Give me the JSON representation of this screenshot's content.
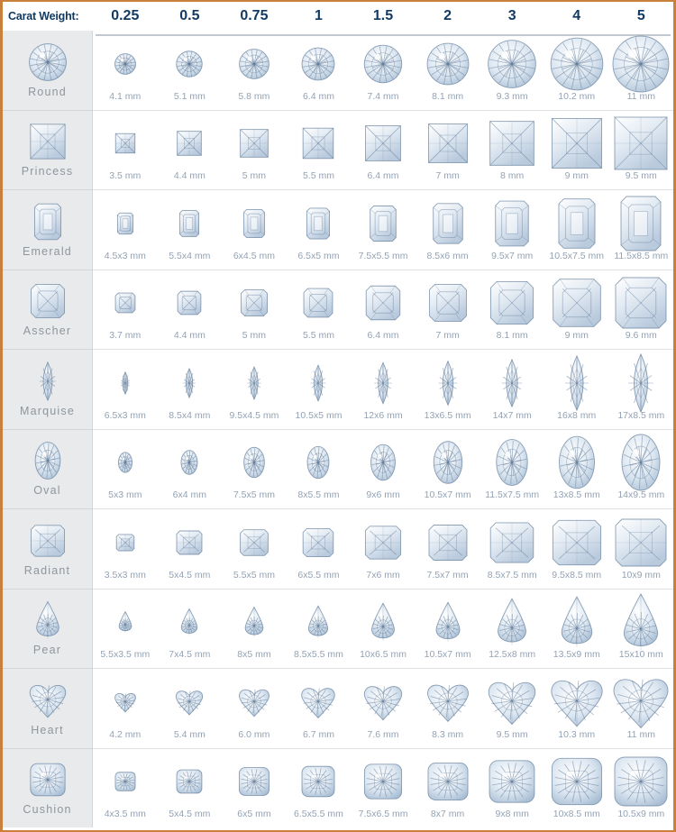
{
  "header": {
    "label": "Carat Weight:",
    "carats": [
      "0.25",
      "0.5",
      "0.75",
      "1",
      "1.5",
      "2",
      "3",
      "4",
      "5"
    ]
  },
  "colors": {
    "border": "#c8803c",
    "header_text": "#123a63",
    "row_label": "#8f969c",
    "cell_text": "#93a2b4",
    "label_bg": "#e8eaec",
    "gem_light": "#ffffff",
    "gem_mid": "#c9d6e4",
    "gem_dark": "#5f7a99",
    "gem_shadow": "#2c4562"
  },
  "rows": [
    {
      "name": "Round",
      "shape": "round-diamond-icon",
      "sizes": [
        "4.1 mm",
        "5.1 mm",
        "5.8 mm",
        "6.4 mm",
        "7.4 mm",
        "8.1 mm",
        "9.3 mm",
        "10.2 mm",
        "11 mm"
      ],
      "scale": [
        0.37,
        0.46,
        0.53,
        0.58,
        0.67,
        0.74,
        0.85,
        0.93,
        1.0
      ]
    },
    {
      "name": "Princess",
      "shape": "princess-diamond-icon",
      "sizes": [
        "3.5 mm",
        "4.4 mm",
        "5 mm",
        "5.5 mm",
        "6.4 mm",
        "7 mm",
        "8 mm",
        "9 mm",
        "9.5 mm"
      ],
      "scale": [
        0.37,
        0.46,
        0.53,
        0.58,
        0.67,
        0.74,
        0.84,
        0.95,
        1.0
      ]
    },
    {
      "name": "Emerald",
      "shape": "emerald-diamond-icon",
      "sizes": [
        "4.5x3 mm",
        "5.5x4 mm",
        "6x4.5 mm",
        "6.5x5 mm",
        "7.5x5.5 mm",
        "8.5x6 mm",
        "9.5x7 mm",
        "10.5x7.5 mm",
        "11.5x8.5 mm"
      ],
      "scale": [
        0.39,
        0.48,
        0.52,
        0.57,
        0.65,
        0.74,
        0.83,
        0.91,
        1.0
      ]
    },
    {
      "name": "Asscher",
      "shape": "asscher-diamond-icon",
      "sizes": [
        "3.7 mm",
        "4.4 mm",
        "5 mm",
        "5.5 mm",
        "6.4 mm",
        "7 mm",
        "8.1 mm",
        "9 mm",
        "9.6 mm"
      ],
      "scale": [
        0.39,
        0.46,
        0.52,
        0.57,
        0.67,
        0.73,
        0.84,
        0.94,
        1.0
      ]
    },
    {
      "name": "Marquise",
      "shape": "marquise-diamond-icon",
      "sizes": [
        "6.5x3 mm",
        "8.5x4 mm",
        "9.5x4.5 mm",
        "10.5x5 mm",
        "12x6 mm",
        "13x6.5 mm",
        "14x7 mm",
        "16x8 mm",
        "17x8.5 mm"
      ],
      "scale": [
        0.38,
        0.5,
        0.56,
        0.62,
        0.71,
        0.76,
        0.82,
        0.94,
        1.0
      ]
    },
    {
      "name": "Oval",
      "shape": "oval-diamond-icon",
      "sizes": [
        "5x3 mm",
        "6x4 mm",
        "7.5x5 mm",
        "8x5.5 mm",
        "9x6 mm",
        "10.5x7 mm",
        "11.5x7.5 mm",
        "13x8.5 mm",
        "14x9.5 mm"
      ],
      "scale": [
        0.36,
        0.43,
        0.54,
        0.57,
        0.64,
        0.75,
        0.82,
        0.93,
        1.0
      ]
    },
    {
      "name": "Radiant",
      "shape": "radiant-diamond-icon",
      "sizes": [
        "3.5x3 mm",
        "5x4.5 mm",
        "5.5x5 mm",
        "6x5.5 mm",
        "7x6 mm",
        "7.5x7 mm",
        "8.5x7.5 mm",
        "9.5x8.5 mm",
        "10x9 mm"
      ],
      "scale": [
        0.35,
        0.5,
        0.55,
        0.6,
        0.7,
        0.75,
        0.85,
        0.95,
        1.0
      ]
    },
    {
      "name": "Pear",
      "shape": "pear-diamond-icon",
      "sizes": [
        "5.5x3.5 mm",
        "7x4.5 mm",
        "8x5 mm",
        "8.5x5.5 mm",
        "10x6.5 mm",
        "10.5x7 mm",
        "12.5x8 mm",
        "13.5x9 mm",
        "15x10 mm"
      ],
      "scale": [
        0.37,
        0.47,
        0.53,
        0.57,
        0.67,
        0.7,
        0.83,
        0.9,
        1.0
      ]
    },
    {
      "name": "Heart",
      "shape": "heart-diamond-icon",
      "sizes": [
        "4.2 mm",
        "5.4 mm",
        "6.0 mm",
        "6.7 mm",
        "7.6 mm",
        "8.3 mm",
        "9.5 mm",
        "10.3 mm",
        "11 mm"
      ],
      "scale": [
        0.38,
        0.49,
        0.55,
        0.61,
        0.69,
        0.75,
        0.86,
        0.94,
        1.0
      ]
    },
    {
      "name": "Cushion",
      "shape": "cushion-diamond-icon",
      "sizes": [
        "4x3.5 mm",
        "5x4.5 mm",
        "6x5 mm",
        "6.5x5.5 mm",
        "7.5x6.5 mm",
        "8x7 mm",
        "9x8 mm",
        "10x8.5 mm",
        "10.5x9 mm"
      ],
      "scale": [
        0.38,
        0.48,
        0.57,
        0.62,
        0.71,
        0.76,
        0.86,
        0.95,
        1.0
      ]
    }
  ]
}
